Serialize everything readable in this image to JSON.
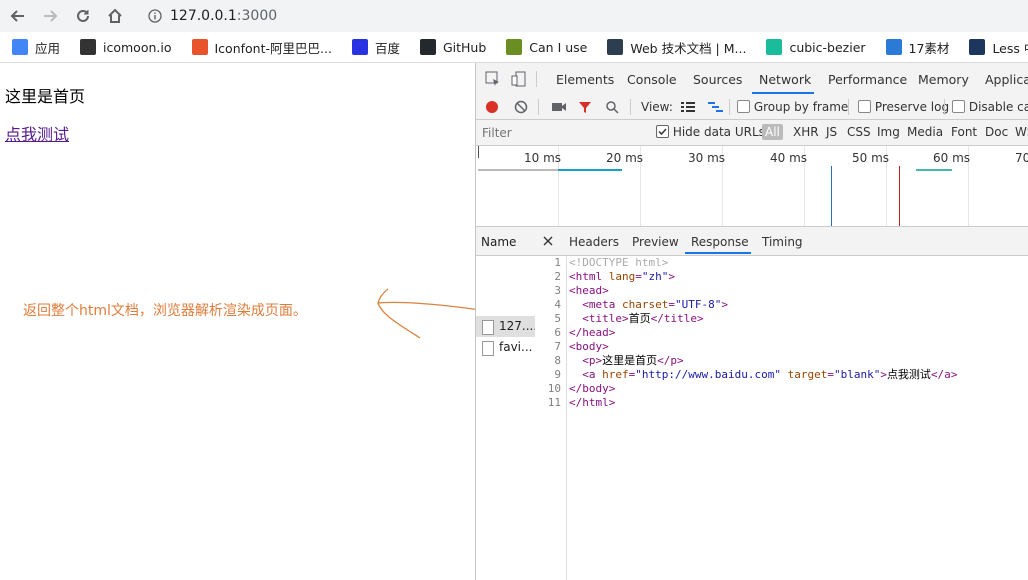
{
  "browser": {
    "url_host": "127.0.0.1",
    "url_port": ":3000"
  },
  "bookmarks": [
    {
      "label": "应用",
      "icon": "apps-grid-icon",
      "color": "#4285f4"
    },
    {
      "label": "icomoon.io",
      "icon": "icomoon-icon",
      "color": "#333333"
    },
    {
      "label": "Iconfont-阿里巴巴...",
      "icon": "iconfont-icon",
      "color": "#e8532b"
    },
    {
      "label": "百度",
      "icon": "baidu-paw-icon",
      "color": "#2932e1"
    },
    {
      "label": "GitHub",
      "icon": "github-icon",
      "color": "#24292e"
    },
    {
      "label": "Can I use",
      "icon": "caniuse-icon",
      "color": "#6b8e23"
    },
    {
      "label": "Web 技术文档 | M...",
      "icon": "mdn-icon",
      "color": "#2c3e50"
    },
    {
      "label": "cubic-bezier",
      "icon": "cubic-bezier-icon",
      "color": "#1abc9c"
    },
    {
      "label": "17素材",
      "icon": "17sucai-icon",
      "color": "#2b7bd6"
    },
    {
      "label": "Less 中文网",
      "icon": "less-icon",
      "color": "#1d365d"
    }
  ],
  "page": {
    "text": "这里是首页",
    "link": "点我测试",
    "annotation": "返回整个html文档，浏览器解析渲染成页面。"
  },
  "devtools": {
    "tabs": [
      "Elements",
      "Console",
      "Sources",
      "Network",
      "Performance",
      "Memory",
      "Applicat"
    ],
    "active_tab": "Network",
    "toolbar": {
      "view_label": "View:",
      "group_by_frame": "Group by frame",
      "preserve_log": "Preserve log",
      "disable_cache": "Disable cac"
    },
    "filter": {
      "placeholder": "Filter",
      "hide_data_urls": "Hide data URLs",
      "types": [
        "All",
        "XHR",
        "JS",
        "CSS",
        "Img",
        "Media",
        "Font",
        "Doc",
        "WS"
      ]
    },
    "timeline": {
      "ticks": [
        "10 ms",
        "20 ms",
        "30 ms",
        "40 ms",
        "50 ms",
        "60 ms",
        "70"
      ]
    },
    "requests": {
      "name_header": "Name",
      "items": [
        "127....",
        "favi..."
      ]
    },
    "response_tabs": [
      "Headers",
      "Preview",
      "Response",
      "Timing"
    ],
    "active_response_tab": "Response",
    "code_lines": [
      "<!DOCTYPE html>",
      "<html lang=\"zh\">",
      "<head>",
      "  <meta charset=\"UTF-8\">",
      "  <title>首页</title>",
      "</head>",
      "<body>",
      "  <p>这里是首页</p>",
      "  <a href=\"http://www.baidu.com\" target=\"blank\">点我测试</a>",
      "</body>",
      "</html>"
    ]
  },
  "colors": {
    "accent": "#1a73e8",
    "annotation": "#e07c3b",
    "record": "#d93025"
  }
}
